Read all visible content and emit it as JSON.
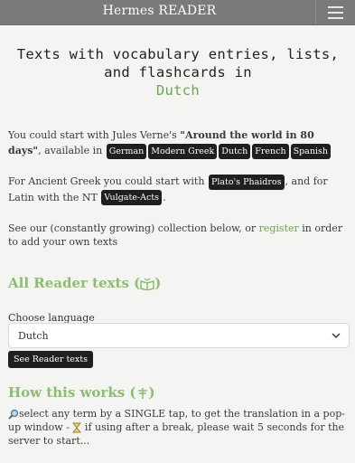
{
  "navbar": {
    "brand": "Hermes READER",
    "menu_icon": "hamburger-icon"
  },
  "hero": {
    "title": "Texts with vocabulary entries, lists, and flashcards in",
    "language": "Dutch"
  },
  "intro": {
    "start_text": "You could start with Jules Verne's",
    "book_title": "\"Around the world in 80 days\"",
    "available_in": ", available in",
    "languages": [
      "German",
      "Modern Greek",
      "Dutch",
      "French",
      "Spanish"
    ]
  },
  "ancient": {
    "text1": "For Ancient Greek you could start with",
    "greek_tag": "Plato's Phaidros",
    "text2": ", and for Latin with the NT",
    "latin_tag": "Vulgate-Acts",
    "end": "."
  },
  "collection": {
    "text1": "See our (constantly growing) collection below, or",
    "register_link": "register",
    "text2": "in order to add your own texts"
  },
  "all_texts": {
    "heading": "All Reader texts (",
    "heading_end": ")",
    "icon": "book-icon"
  },
  "language_select": {
    "label": "Choose language",
    "value": "Dutch"
  },
  "see_button": {
    "label": "See Reader texts"
  },
  "how": {
    "heading": "How this works (",
    "heading_end": ")",
    "icon": "signpost-icon"
  },
  "tips": {
    "tap_icon": "magnifier-icon",
    "tap_text": "select any term by a SINGLE tap, to get the translation in a pop-up window - ",
    "hourglass_icon": "hourglass-icon",
    "wait_text": " if using after a break, please wait 5 seconds for the server to start..."
  },
  "colors": {
    "navbar": "#7a7a7a",
    "accent": "#6aa84f",
    "heading": "#8bbf6e",
    "tag_bg": "#1f1f1f"
  }
}
